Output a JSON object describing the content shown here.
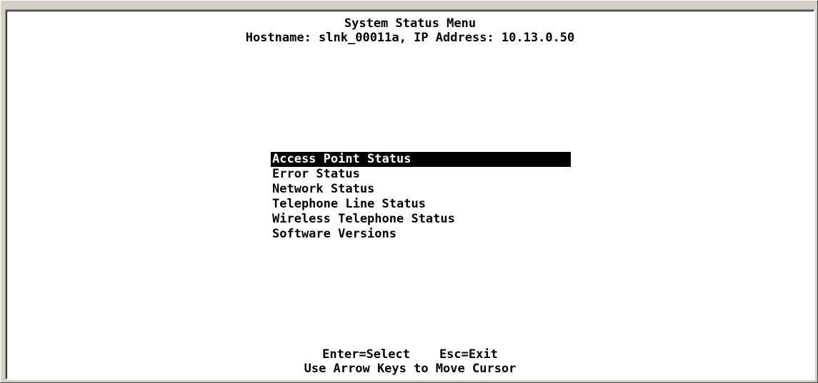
{
  "screen": {
    "title": "System Status Menu",
    "hostname_line": "Hostname: slnk_00011a, IP Address: 10.13.0.50"
  },
  "menu": {
    "selected_index": 0,
    "items": [
      {
        "label": "Access Point Status"
      },
      {
        "label": "Error Status"
      },
      {
        "label": "Network Status"
      },
      {
        "label": "Telephone Line Status"
      },
      {
        "label": "Wireless Telephone Status"
      },
      {
        "label": "Software Versions"
      }
    ]
  },
  "footer": {
    "enter_key": "Enter=Select",
    "esc_key": "Esc=Exit",
    "hint": "Use Arrow Keys to Move Cursor"
  },
  "colors": {
    "background": "#ffffff",
    "text": "#000000",
    "highlight_bg": "#000000",
    "highlight_text": "#ffffff",
    "window_chrome": "#d4d0c8"
  }
}
